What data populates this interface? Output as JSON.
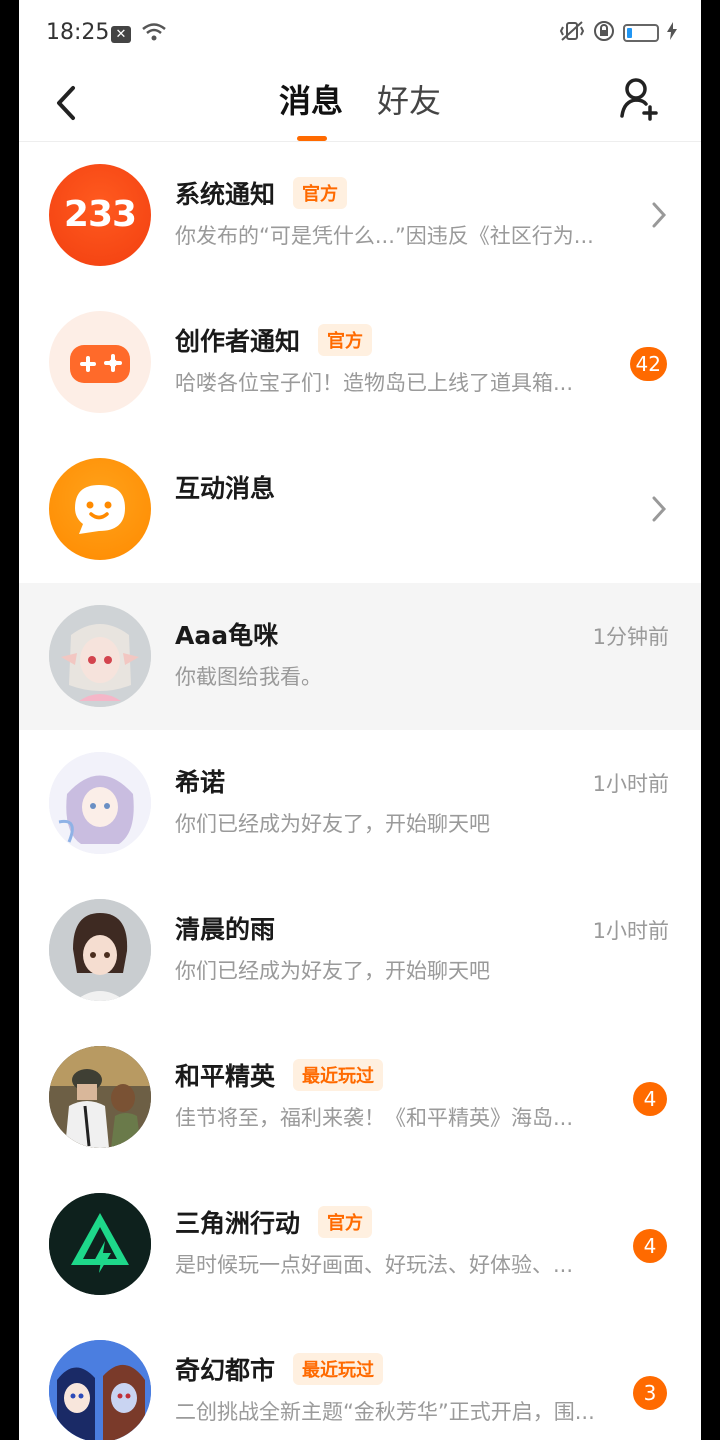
{
  "status_bar": {
    "time": "18:25"
  },
  "header": {
    "tabs": [
      {
        "label": "消息",
        "active": true
      },
      {
        "label": "好友",
        "active": false
      }
    ]
  },
  "colors": {
    "accent": "#ff6a00",
    "badge_bg": "#fff0e0",
    "muted_text": "#9a9a9a"
  },
  "conversations": [
    {
      "name": "系统通知",
      "badge": "官方",
      "preview": "你发布的“可是凭什么...”因违反《社区行为...",
      "right": "chevron",
      "avatar_icon": "233-logo-icon",
      "avatar_text": "233"
    },
    {
      "name": "创作者通知",
      "badge": "官方",
      "preview": "哈喽各位宝子们！造物岛已上线了道具箱...",
      "unread": "42",
      "avatar_icon": "gamepad-icon"
    },
    {
      "name": "互动消息",
      "preview": "",
      "right": "chevron",
      "avatar_icon": "chat-smile-icon"
    },
    {
      "name": "Aaa龟咪",
      "preview": "你截图给我看。",
      "time": "1分钟前",
      "avatar_icon": "user-avatar"
    },
    {
      "name": "希诺",
      "preview": "你们已经成为好友了，开始聊天吧",
      "time": "1小时前",
      "avatar_icon": "user-avatar"
    },
    {
      "name": "清晨的雨",
      "preview": "你们已经成为好友了，开始聊天吧",
      "time": "1小时前",
      "avatar_icon": "user-avatar"
    },
    {
      "name": "和平精英",
      "badge": "最近玩过",
      "preview": "佳节将至，福利来袭！《和平精英》海岛...",
      "unread": "4",
      "avatar_icon": "game-avatar"
    },
    {
      "name": "三角洲行动",
      "badge": "官方",
      "preview": "是时候玩一点好画面、好玩法、好体验、...",
      "unread": "4",
      "avatar_icon": "delta-logo-icon"
    },
    {
      "name": "奇幻都市",
      "badge": "最近玩过",
      "preview": "二创挑战全新主题“金秋芳华”正式开启，围...",
      "unread": "3",
      "avatar_icon": "game-avatar"
    }
  ]
}
